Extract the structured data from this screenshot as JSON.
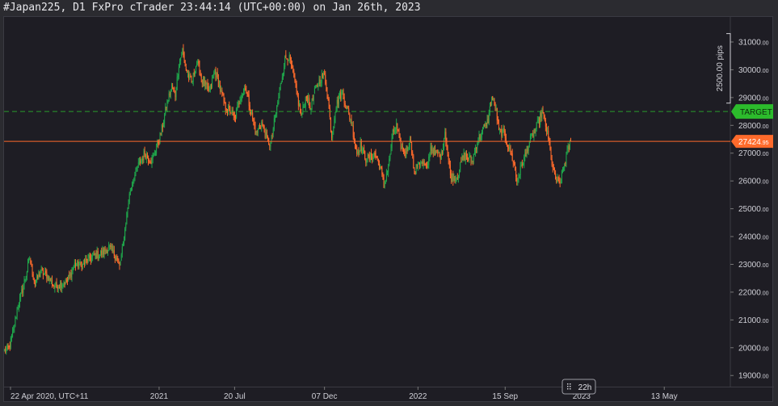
{
  "window": {
    "title": "#Japan225, D1 FxPro cTrader 23:44:14 (UTC+00:00) on Jan 26th, 2023"
  },
  "chart_data": {
    "type": "candlestick",
    "symbol": "#Japan225",
    "timeframe": "D1",
    "ylim": [
      18600,
      31900
    ],
    "y_ticks": [
      {
        "value": 19000,
        "int": "19000",
        "dec": ".00"
      },
      {
        "value": 20000,
        "int": "20000",
        "dec": ".00"
      },
      {
        "value": 21000,
        "int": "21000",
        "dec": ".00"
      },
      {
        "value": 22000,
        "int": "22000",
        "dec": ".00"
      },
      {
        "value": 23000,
        "int": "23000",
        "dec": ".00"
      },
      {
        "value": 24000,
        "int": "24000",
        "dec": ".00"
      },
      {
        "value": 25000,
        "int": "25000",
        "dec": ".00"
      },
      {
        "value": 26000,
        "int": "26000",
        "dec": ".00"
      },
      {
        "value": 27000,
        "int": "27000",
        "dec": ".00"
      },
      {
        "value": 28000,
        "int": "28000",
        "dec": ".00"
      },
      {
        "value": 29000,
        "int": "29000",
        "dec": ".00"
      },
      {
        "value": 30000,
        "int": "30000",
        "dec": ".00"
      },
      {
        "value": 31000,
        "int": "31000",
        "dec": ".00"
      }
    ],
    "x_ticks": [
      {
        "label": "22 Apr 2020, UTC+11",
        "index": 0
      },
      {
        "label": "2021",
        "index": 172
      },
      {
        "label": "20 Jul",
        "index": 256
      },
      {
        "label": "07 Dec",
        "index": 356
      },
      {
        "label": "2022",
        "index": 460
      },
      {
        "label": "15 Sep",
        "index": 557
      },
      {
        "label": "2023",
        "index": 642
      },
      {
        "label": "13 May",
        "index": 734
      }
    ],
    "n_slots": 808,
    "series": [
      {
        "type": "ohlc",
        "anchors": [
          [
            0,
            19900
          ],
          [
            5,
            20000
          ],
          [
            10,
            20600
          ],
          [
            14,
            21400
          ],
          [
            20,
            22100
          ],
          [
            28,
            23200
          ],
          [
            34,
            22300
          ],
          [
            40,
            22700
          ],
          [
            48,
            22600
          ],
          [
            55,
            22200
          ],
          [
            62,
            22300
          ],
          [
            70,
            22400
          ],
          [
            78,
            23000
          ],
          [
            86,
            22950
          ],
          [
            94,
            23200
          ],
          [
            100,
            23300
          ],
          [
            108,
            23400
          ],
          [
            116,
            23600
          ],
          [
            124,
            23300
          ],
          [
            128,
            22900
          ],
          [
            132,
            23700
          ],
          [
            136,
            24800
          ],
          [
            140,
            25700
          ],
          [
            148,
            26500
          ],
          [
            156,
            27000
          ],
          [
            164,
            26700
          ],
          [
            168,
            27100
          ],
          [
            172,
            27500
          ],
          [
            176,
            28000
          ],
          [
            180,
            28700
          ],
          [
            186,
            29400
          ],
          [
            190,
            29100
          ],
          [
            194,
            30200
          ],
          [
            198,
            30700
          ],
          [
            202,
            30000
          ],
          [
            208,
            29500
          ],
          [
            214,
            30300
          ],
          [
            220,
            29600
          ],
          [
            228,
            29200
          ],
          [
            234,
            30000
          ],
          [
            240,
            29300
          ],
          [
            246,
            28600
          ],
          [
            252,
            28500
          ],
          [
            256,
            28200
          ],
          [
            262,
            29000
          ],
          [
            268,
            29400
          ],
          [
            274,
            28500
          ],
          [
            280,
            27700
          ],
          [
            286,
            28100
          ],
          [
            292,
            27500
          ],
          [
            296,
            27300
          ],
          [
            300,
            28100
          ],
          [
            306,
            29200
          ],
          [
            312,
            30400
          ],
          [
            316,
            30500
          ],
          [
            320,
            30000
          ],
          [
            326,
            29000
          ],
          [
            330,
            28300
          ],
          [
            336,
            29100
          ],
          [
            340,
            28600
          ],
          [
            346,
            29300
          ],
          [
            352,
            29700
          ],
          [
            356,
            29800
          ],
          [
            360,
            28900
          ],
          [
            364,
            27600
          ],
          [
            368,
            28600
          ],
          [
            372,
            29000
          ],
          [
            376,
            29200
          ],
          [
            380,
            28700
          ],
          [
            386,
            28100
          ],
          [
            392,
            27000
          ],
          [
            396,
            27300
          ],
          [
            402,
            26800
          ],
          [
            406,
            26800
          ],
          [
            412,
            27000
          ],
          [
            418,
            26500
          ],
          [
            422,
            25800
          ],
          [
            428,
            26700
          ],
          [
            432,
            27700
          ],
          [
            436,
            28000
          ],
          [
            440,
            27300
          ],
          [
            446,
            27000
          ],
          [
            452,
            27500
          ],
          [
            456,
            26200
          ],
          [
            460,
            26700
          ],
          [
            466,
            26600
          ],
          [
            470,
            26400
          ],
          [
            474,
            27200
          ],
          [
            480,
            27000
          ],
          [
            486,
            26900
          ],
          [
            490,
            27800
          ],
          [
            496,
            26200
          ],
          [
            502,
            26100
          ],
          [
            506,
            26400
          ],
          [
            510,
            26900
          ],
          [
            514,
            26900
          ],
          [
            520,
            26700
          ],
          [
            526,
            27400
          ],
          [
            532,
            27800
          ],
          [
            538,
            28200
          ],
          [
            542,
            29000
          ],
          [
            546,
            28700
          ],
          [
            550,
            27800
          ],
          [
            556,
            27700
          ],
          [
            560,
            27300
          ],
          [
            566,
            26700
          ],
          [
            570,
            26000
          ],
          [
            576,
            26600
          ],
          [
            580,
            27000
          ],
          [
            584,
            27400
          ],
          [
            590,
            27800
          ],
          [
            594,
            28100
          ],
          [
            598,
            28500
          ],
          [
            602,
            28000
          ],
          [
            606,
            27300
          ],
          [
            610,
            26400
          ],
          [
            614,
            26000
          ],
          [
            618,
            25900
          ],
          [
            622,
            26500
          ],
          [
            626,
            27000
          ],
          [
            630,
            27424
          ]
        ]
      }
    ],
    "current_price": {
      "value": 27424.95,
      "int": "27424",
      "dec": ".95",
      "color": "#ff6a2b"
    },
    "target": {
      "value": 28500,
      "label": "TARGET",
      "color": "#2cbb2c"
    },
    "measure": {
      "label": "2500.00 pips",
      "from": 28800,
      "to": 31300
    },
    "time_badge": "22h",
    "colors": {
      "up": "#1fa64b",
      "down": "#ff6a2b",
      "background": "#1e1d24"
    }
  }
}
